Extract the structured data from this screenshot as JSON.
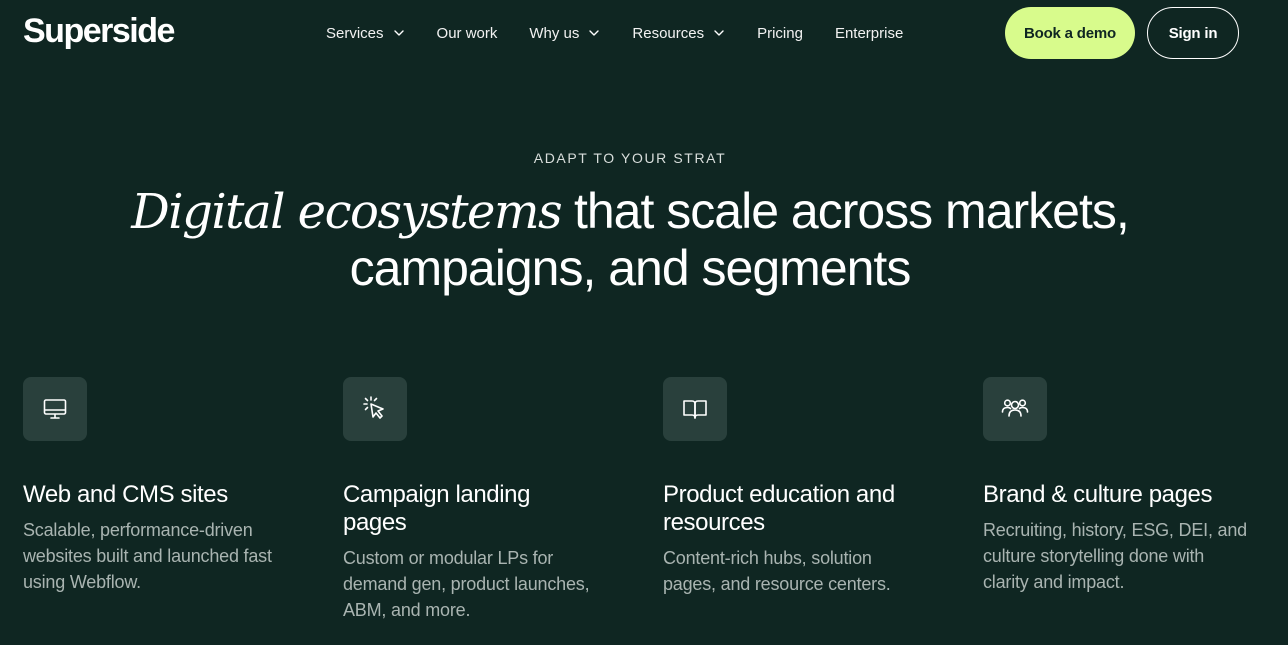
{
  "brand": {
    "logo_text": "Superside"
  },
  "nav": {
    "items": [
      {
        "label": "Services",
        "has_dropdown": true
      },
      {
        "label": "Our work",
        "has_dropdown": false
      },
      {
        "label": "Why us",
        "has_dropdown": true
      },
      {
        "label": "Resources",
        "has_dropdown": true
      },
      {
        "label": "Pricing",
        "has_dropdown": false
      },
      {
        "label": "Enterprise",
        "has_dropdown": false
      }
    ],
    "demo_label": "Book a demo",
    "signin_label": "Sign in"
  },
  "hero": {
    "eyebrow": "ADAPT TO YOUR STRAT",
    "headline_italic": "Digital ecosystems",
    "headline_rest_1": " that scale across markets,",
    "headline_rest_2": "campaigns, and segments"
  },
  "cards": [
    {
      "icon": "monitor-icon",
      "title": "Web and CMS sites",
      "description": "Scalable, performance-driven websites built and launched fast using Webflow."
    },
    {
      "icon": "cursor-click-icon",
      "title": "Campaign landing pages",
      "description": "Custom or modular LPs for demand gen, product launches, ABM, and more."
    },
    {
      "icon": "open-book-icon",
      "title": "Product education and resources",
      "description": "Content-rich hubs, solution pages, and resource centers."
    },
    {
      "icon": "users-group-icon",
      "title": "Brand & culture pages",
      "description": "Recruiting, history, ESG, DEI, and culture storytelling done with clarity and impact."
    }
  ],
  "colors": {
    "background": "#0f2622",
    "accent": "#d8fb8c",
    "icon_box": "#29403c",
    "muted_text": "#a9b4b1"
  }
}
